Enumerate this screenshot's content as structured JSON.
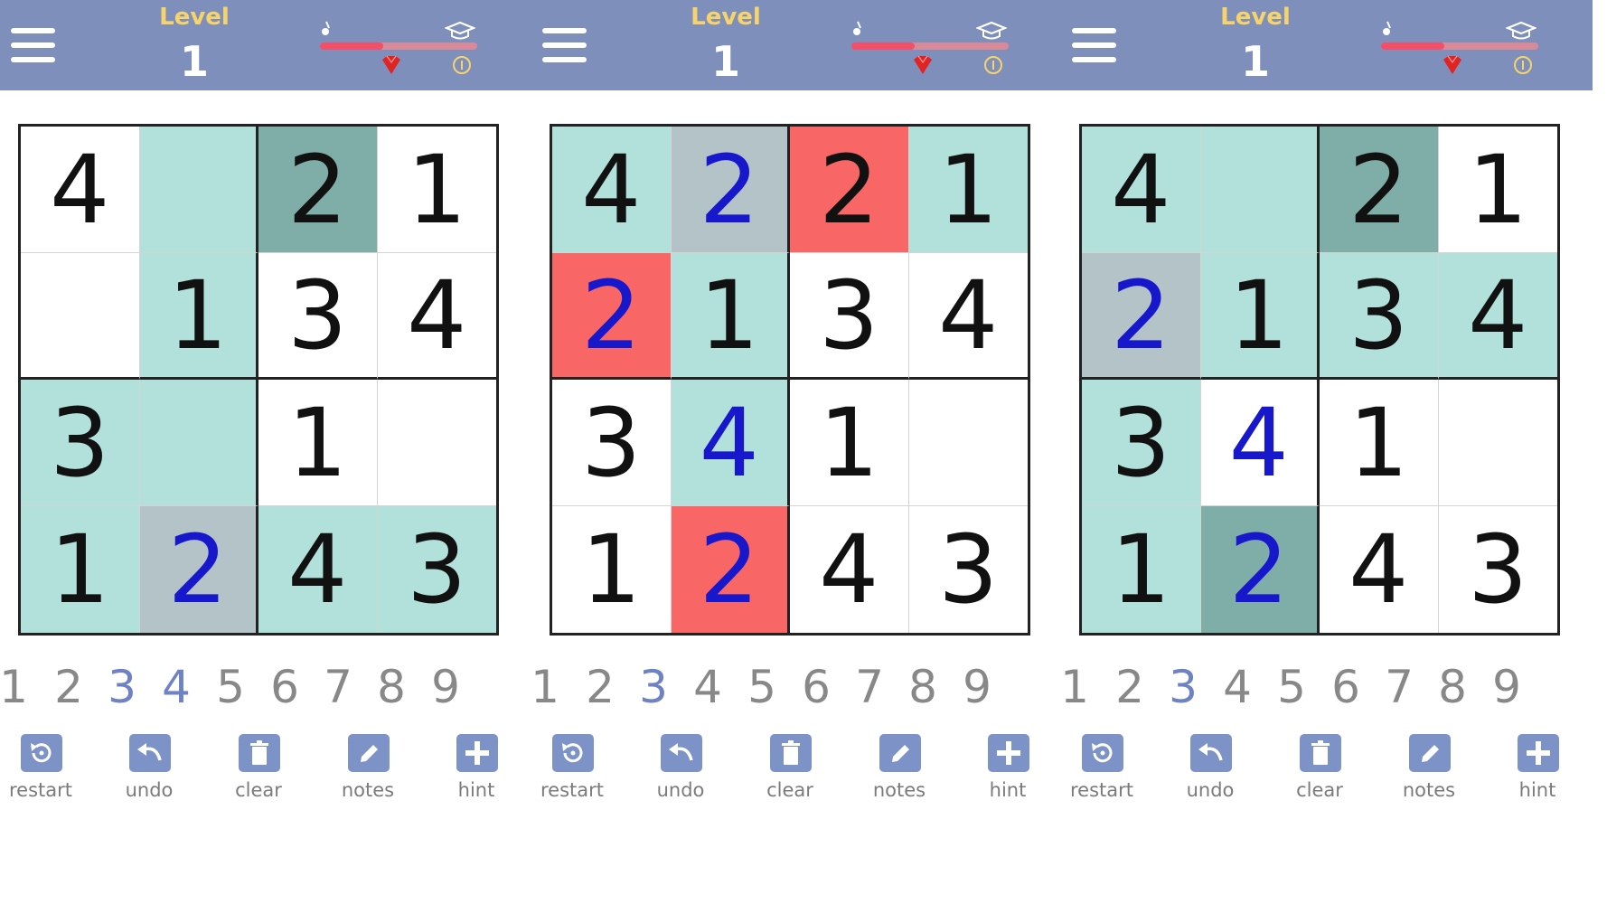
{
  "colors": {
    "header": "#7e8fbc",
    "cell_default": "#ffffff",
    "cell_highlight": "#b2e1dc",
    "cell_selected": "#7fada8",
    "cell_same_value": "#b4c3c8",
    "cell_conflict": "#f86666",
    "given_digit": "#111111",
    "user_digit": "#1717cc",
    "numpad_digit": "#888888",
    "numpad_active": "#6e82c4",
    "tool_icon": "#7d92c7",
    "tool_label": "#7b7b7b"
  },
  "panels": [
    {
      "header": {
        "level_label": "Level",
        "level_value": "1",
        "progress": 0.4
      },
      "grid": [
        [
          {
            "v": "4",
            "bg": "cell_default",
            "u": false
          },
          {
            "v": "",
            "bg": "cell_highlight",
            "u": false
          },
          {
            "v": "2",
            "bg": "cell_selected",
            "u": false
          },
          {
            "v": "1",
            "bg": "cell_default",
            "u": false
          }
        ],
        [
          {
            "v": "",
            "bg": "cell_default",
            "u": false
          },
          {
            "v": "1",
            "bg": "cell_highlight",
            "u": false
          },
          {
            "v": "3",
            "bg": "cell_default",
            "u": false
          },
          {
            "v": "4",
            "bg": "cell_default",
            "u": false
          }
        ],
        [
          {
            "v": "3",
            "bg": "cell_highlight",
            "u": false
          },
          {
            "v": "",
            "bg": "cell_highlight",
            "u": false
          },
          {
            "v": "1",
            "bg": "cell_default",
            "u": false
          },
          {
            "v": "",
            "bg": "cell_default",
            "u": false
          }
        ],
        [
          {
            "v": "1",
            "bg": "cell_highlight",
            "u": false
          },
          {
            "v": "2",
            "bg": "cell_same_value",
            "u": true
          },
          {
            "v": "4",
            "bg": "cell_highlight",
            "u": false
          },
          {
            "v": "3",
            "bg": "cell_highlight",
            "u": false
          }
        ]
      ],
      "numpad_active": [
        3,
        4
      ]
    },
    {
      "header": {
        "level_label": "Level",
        "level_value": "1",
        "progress": 0.4
      },
      "grid": [
        [
          {
            "v": "4",
            "bg": "cell_highlight",
            "u": false
          },
          {
            "v": "2",
            "bg": "cell_same_value",
            "u": true
          },
          {
            "v": "2",
            "bg": "cell_conflict",
            "u": false
          },
          {
            "v": "1",
            "bg": "cell_highlight",
            "u": false
          }
        ],
        [
          {
            "v": "2",
            "bg": "cell_conflict",
            "u": true
          },
          {
            "v": "1",
            "bg": "cell_highlight",
            "u": false
          },
          {
            "v": "3",
            "bg": "cell_default",
            "u": false
          },
          {
            "v": "4",
            "bg": "cell_default",
            "u": false
          }
        ],
        [
          {
            "v": "3",
            "bg": "cell_default",
            "u": false
          },
          {
            "v": "4",
            "bg": "cell_highlight",
            "u": true
          },
          {
            "v": "1",
            "bg": "cell_default",
            "u": false
          },
          {
            "v": "",
            "bg": "cell_default",
            "u": false
          }
        ],
        [
          {
            "v": "1",
            "bg": "cell_default",
            "u": false
          },
          {
            "v": "2",
            "bg": "cell_conflict",
            "u": true
          },
          {
            "v": "4",
            "bg": "cell_default",
            "u": false
          },
          {
            "v": "3",
            "bg": "cell_default",
            "u": false
          }
        ]
      ],
      "numpad_active": [
        3
      ]
    },
    {
      "header": {
        "level_label": "Level",
        "level_value": "1",
        "progress": 0.4
      },
      "grid": [
        [
          {
            "v": "4",
            "bg": "cell_highlight",
            "u": false
          },
          {
            "v": "",
            "bg": "cell_highlight",
            "u": false
          },
          {
            "v": "2",
            "bg": "cell_selected",
            "u": false
          },
          {
            "v": "1",
            "bg": "cell_default",
            "u": false
          }
        ],
        [
          {
            "v": "2",
            "bg": "cell_same_value",
            "u": true
          },
          {
            "v": "1",
            "bg": "cell_highlight",
            "u": false
          },
          {
            "v": "3",
            "bg": "cell_highlight",
            "u": false
          },
          {
            "v": "4",
            "bg": "cell_highlight",
            "u": false
          }
        ],
        [
          {
            "v": "3",
            "bg": "cell_highlight",
            "u": false
          },
          {
            "v": "4",
            "bg": "cell_default",
            "u": true
          },
          {
            "v": "1",
            "bg": "cell_default",
            "u": false
          },
          {
            "v": "",
            "bg": "cell_default",
            "u": false
          }
        ],
        [
          {
            "v": "1",
            "bg": "cell_highlight",
            "u": false
          },
          {
            "v": "2",
            "bg": "cell_selected",
            "u": true
          },
          {
            "v": "4",
            "bg": "cell_default",
            "u": false
          },
          {
            "v": "3",
            "bg": "cell_default",
            "u": false
          }
        ]
      ],
      "numpad_active": [
        3
      ]
    }
  ],
  "numpad": [
    "1",
    "2",
    "3",
    "4",
    "5",
    "6",
    "7",
    "8",
    "9"
  ],
  "toolbar": [
    {
      "label": "restart",
      "icon": "restart-icon"
    },
    {
      "label": "undo",
      "icon": "undo-icon"
    },
    {
      "label": "clear",
      "icon": "trash-icon"
    },
    {
      "label": "notes",
      "icon": "pencil-icon"
    },
    {
      "label": "hint",
      "icon": "plus-icon"
    }
  ],
  "header_icons": [
    "guitar-icon",
    "graduation-cap-icon",
    "heart-gem-icon",
    "coin-icon"
  ]
}
